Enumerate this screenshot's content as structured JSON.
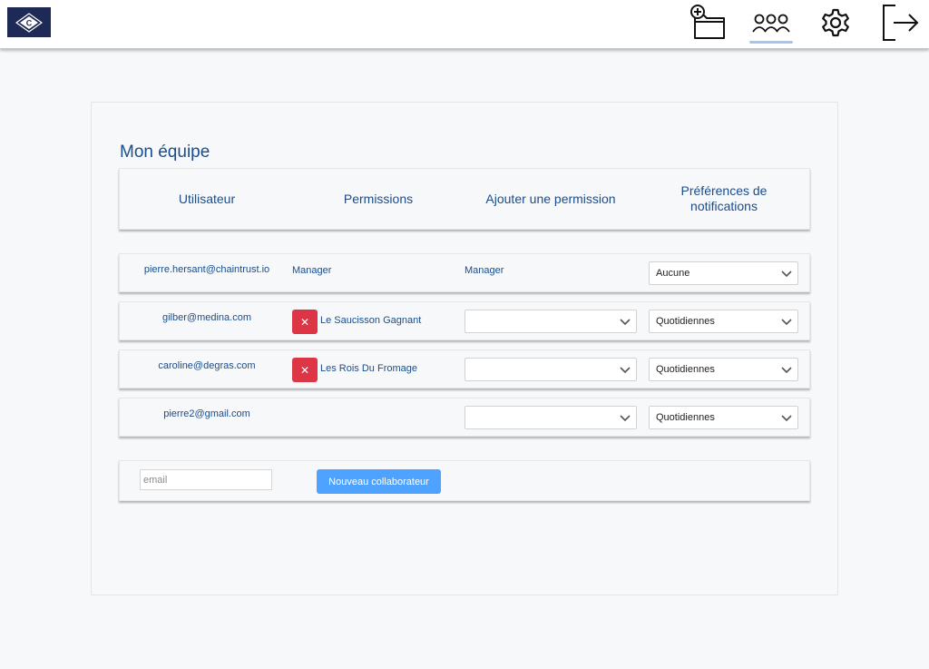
{
  "header": {
    "logo_letter": "C",
    "nav": [
      {
        "icon": "folder-add-icon"
      },
      {
        "icon": "team-icon",
        "active": true
      },
      {
        "icon": "gear-icon"
      },
      {
        "icon": "logout-icon"
      }
    ]
  },
  "page": {
    "title": "Mon équipe"
  },
  "table": {
    "headers": {
      "user": "Utilisateur",
      "permissions": "Permissions",
      "add_permission": "Ajouter une permission",
      "notifications": "Préférences de notifications"
    },
    "rows": [
      {
        "email": "pierre.hersant@chaintrust.io",
        "permission": "Manager",
        "add_permission": "Manager",
        "notification": "Aucune"
      },
      {
        "email": "gilber@medina.com",
        "permission": "Le Saucisson Gagnant",
        "remove_label": "✕",
        "add_permission": "",
        "notification": "Quotidiennes"
      },
      {
        "email": "caroline@degras.com",
        "permission": "Les Rois Du Fromage",
        "remove_label": "✕",
        "add_permission": "",
        "notification": "Quotidiennes"
      },
      {
        "email": "pierre2@gmail.com",
        "permission": "",
        "add_permission": "",
        "notification": "Quotidiennes"
      }
    ]
  },
  "new_member": {
    "email_placeholder": "email",
    "button_label": "Nouveau collaborateur"
  },
  "colors": {
    "primary_text": "#1a4d8c",
    "danger": "#dc3545",
    "button_primary": "#4da3ff",
    "logo_bg": "#1e2a55",
    "active_nav": "#a9c4ee"
  }
}
